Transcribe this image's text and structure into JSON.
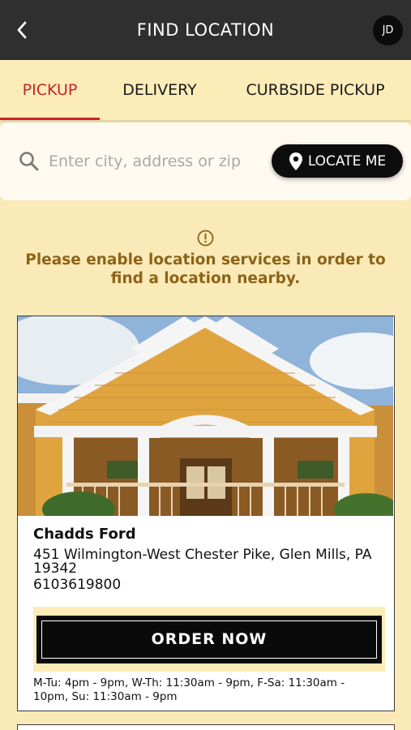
{
  "header": {
    "title": "FIND LOCATION",
    "avatar_initials": "JD",
    "icons": {
      "back": "chevron-left-icon"
    }
  },
  "tabs": [
    {
      "label": "PICKUP",
      "active": true
    },
    {
      "label": "DELIVERY",
      "active": false
    },
    {
      "label": "CURBSIDE PICKUP",
      "active": false
    }
  ],
  "search": {
    "placeholder": "Enter city, address or zip",
    "value": "",
    "locate_label": "LOCATE ME",
    "icons": {
      "search": "search-icon",
      "locate": "location-pin-icon"
    }
  },
  "notice": {
    "icon": "info-circle-icon",
    "text": "Please enable location services in order to find a location nearby."
  },
  "locations": [
    {
      "name": "Chadds Ford",
      "address": "451 Wilmington-West Chester Pike, Glen Mills, PA 19342",
      "phone": "6103619800",
      "order_label": "ORDER NOW",
      "hours": "M-Tu: 4pm - 9pm, W-Th: 11:30am - 9pm, F-Sa: 11:30am - 10pm, Su: 11:30am - 9pm",
      "image": "restaurant-building-photo"
    }
  ],
  "colors": {
    "header_bg": "#2f2f2f",
    "page_bg": "#faeab8",
    "accent_red": "#c8232c",
    "notice_text": "#8d6318",
    "button_black": "#0a0a0a"
  }
}
